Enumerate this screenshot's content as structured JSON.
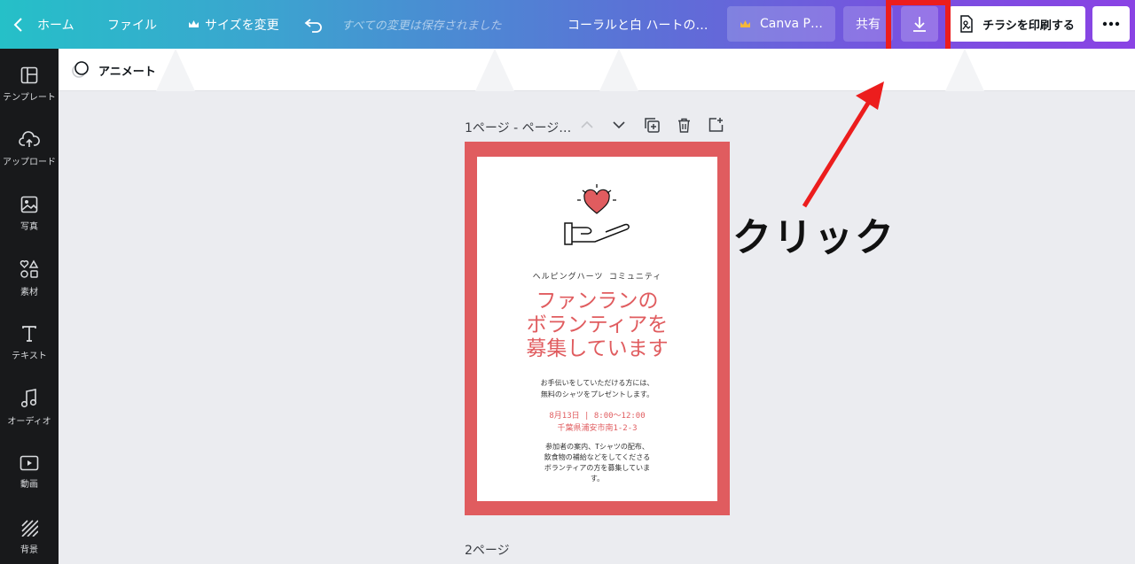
{
  "topbar": {
    "home_label": "ホーム",
    "file_label": "ファイル",
    "resize_label": "サイズを変更",
    "saved_status": "すべての変更は保存されました",
    "doc_title": "コーラルと白 ハートの…",
    "pro_label": "Canva P…",
    "share_label": "共有",
    "print_label": "チラシを印刷する"
  },
  "sidebar": {
    "items": [
      {
        "label": "テンプレート",
        "icon": "template-icon"
      },
      {
        "label": "アップロード",
        "icon": "upload-icon"
      },
      {
        "label": "写真",
        "icon": "photo-icon"
      },
      {
        "label": "素材",
        "icon": "elements-icon"
      },
      {
        "label": "テキスト",
        "icon": "text-icon"
      },
      {
        "label": "オーディオ",
        "icon": "audio-icon"
      },
      {
        "label": "動画",
        "icon": "video-icon"
      },
      {
        "label": "背景",
        "icon": "background-icon"
      }
    ]
  },
  "subbar": {
    "animate_label": "アニメート"
  },
  "page1": {
    "label": "1ページ - ページ…"
  },
  "page2": {
    "label": "2ページ"
  },
  "flyer": {
    "org": "ヘルピングハーツ コミュニティ",
    "title_lines": [
      "ファンランの",
      "ボランティアを",
      "募集しています"
    ],
    "desc_lines": [
      "お手伝いをしていただける方には、",
      "無料のシャツをプレゼントします。"
    ],
    "date_line": "8月13日 | 8:00〜12:00",
    "address_line": "千葉県浦安市南1-2-3",
    "detail_lines": [
      "参加者の案内、Tシャツの配布、",
      "飲食物の補給などをしてくださる",
      "ボランティアの方を募集していま",
      "す。"
    ]
  },
  "annotation": {
    "click_label": "クリック"
  },
  "colors": {
    "accent": "#e05c5f",
    "highlight": "#ec1d1d",
    "sidebar_bg": "#18191b"
  }
}
